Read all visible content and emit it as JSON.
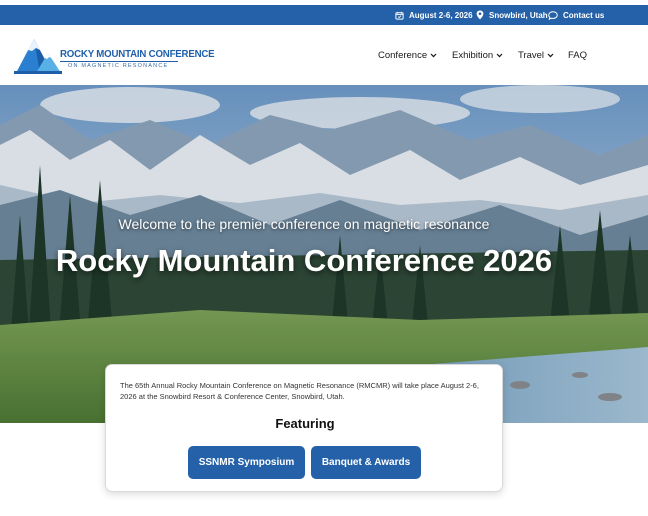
{
  "topbar": {
    "date": "August 2-6, 2026",
    "location": "Snowbird, Utah",
    "contact": "Contact us"
  },
  "logo": {
    "title": "ROCKY MOUNTAIN CONFERENCE",
    "subtitle": "ON MAGNETIC RESONANCE"
  },
  "nav": {
    "items": [
      {
        "label": "Conference",
        "has_dropdown": true
      },
      {
        "label": "Exhibition",
        "has_dropdown": true
      },
      {
        "label": "Travel",
        "has_dropdown": true
      },
      {
        "label": "FAQ",
        "has_dropdown": false
      }
    ]
  },
  "hero": {
    "welcome": "Welcome to the premier conference on magnetic resonance",
    "title": "Rocky Mountain Conference 2026"
  },
  "card": {
    "description": "The 65th Annual Rocky Mountain Conference on Magnetic Resonance (RMCMR) will take place August 2-6, 2026 at the Snowbird Resort & Conference Center, Snowbird, Utah.",
    "featuring": "Featuring",
    "buttons": [
      "SSNMR Symposium",
      "Banquet & Awards"
    ]
  },
  "colors": {
    "brand_blue": "#2461a8",
    "white": "#ffffff"
  },
  "icons": [
    "calendar-icon",
    "location-pin-icon",
    "chat-bubble-icon",
    "chevron-down-icon",
    "mountain-logo-icon"
  ]
}
